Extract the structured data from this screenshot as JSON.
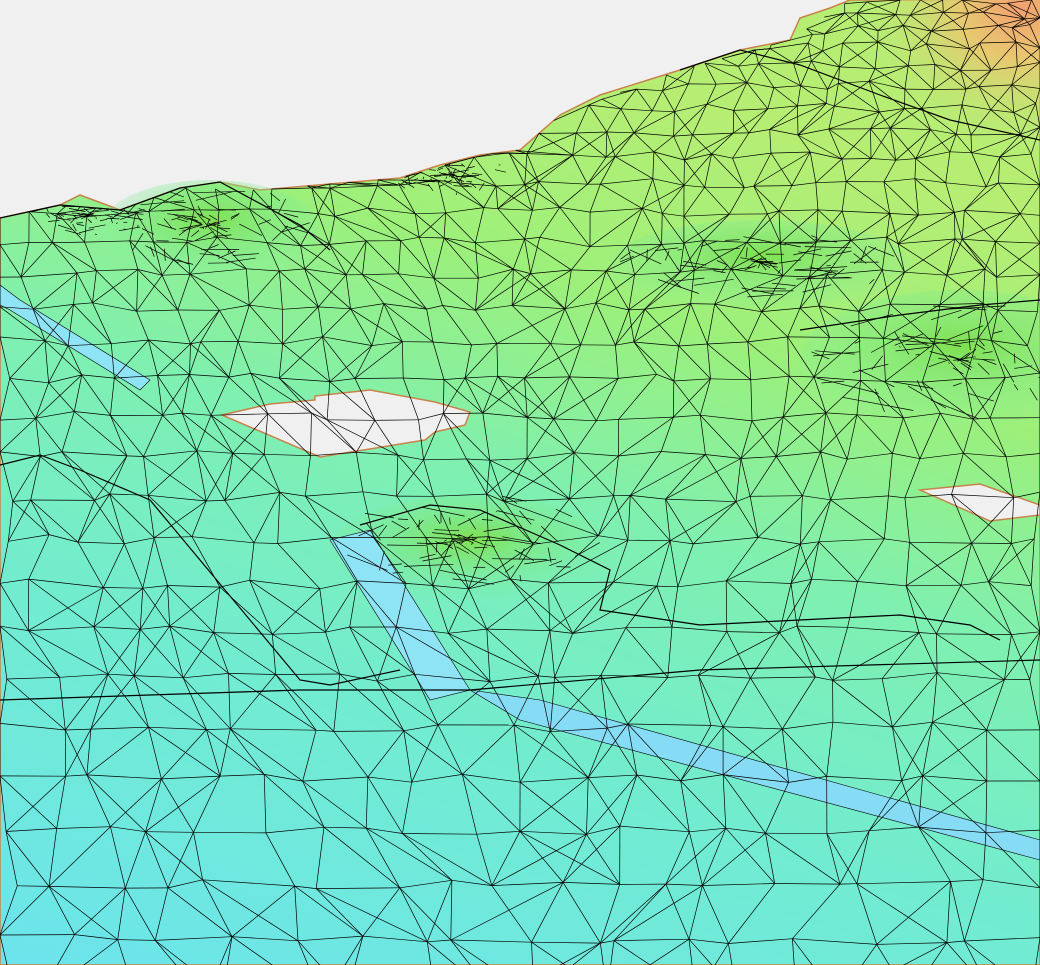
{
  "viewport": {
    "background": "#f0f0f0",
    "mesh_color": "#000000",
    "outline_color": "#c8824a"
  },
  "terrain": {
    "colormap": "elevation",
    "colors": {
      "low": "#6fe6e8",
      "mid": "#7ff0b0",
      "high": "#9ef070",
      "peak": "#f0a070"
    },
    "holes": [
      "hole-center",
      "hole-right"
    ],
    "features": [
      "ridge-left",
      "ridge-center",
      "peak-top-right",
      "channel-cuts"
    ]
  }
}
